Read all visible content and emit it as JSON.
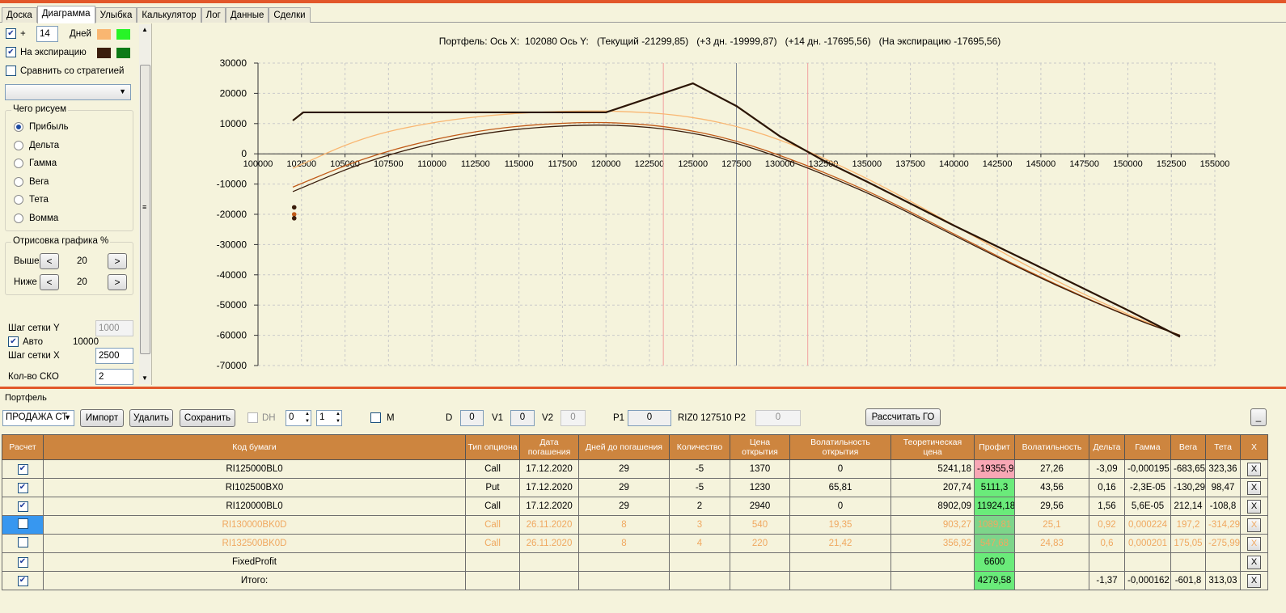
{
  "tabs": [
    "Доска",
    "Диаграмма",
    "Улыбка",
    "Калькулятор",
    "Лог",
    "Данные",
    "Сделки"
  ],
  "left": {
    "plus_label": "+",
    "days_value": "14",
    "days_label": "Дней",
    "expiry_label": "На экспирацию",
    "compare_label": "Сравнить со стратегией",
    "draw_group": "Чего рисуем",
    "radios": [
      "Прибыль",
      "Дельта",
      "Гамма",
      "Вега",
      "Тета",
      "Вомма"
    ],
    "render_group": "Отрисовка графика %",
    "above_label": "Выше",
    "above_value": "20",
    "below_label": "Ниже",
    "below_value": "20",
    "ystep_label": "Шаг сетки Y",
    "ystep_value": "1000",
    "auto_label": "Авто",
    "auto_value": "10000",
    "xstep_label": "Шаг сетки X",
    "xstep_value": "2500",
    "sko_label": "Кол-во СКО",
    "sko_value": "2",
    "colors": {
      "plus_days_1": "#f9b671",
      "plus_days_2": "#27f427",
      "expiry_1": "#3a1d0c",
      "expiry_2": "#0c7a16"
    }
  },
  "chart_data": {
    "type": "line",
    "title": "Портфель: Ось X:  102080 Ось Y:   (Текущий -21299,85)   (+3 дн. -19999,87)   (+14 дн. -17695,56)   (На экспирацию -17695,56)",
    "xlim": [
      100000,
      155000
    ],
    "ylim": [
      -70000,
      30000
    ],
    "x_ticks": [
      "100000",
      "102500",
      "105000",
      "107500",
      "110000",
      "112500",
      "115000",
      "117500",
      "120000",
      "122500",
      "125000",
      "127500",
      "130000",
      "132500",
      "135000",
      "137500",
      "140000",
      "142500",
      "145000",
      "147500",
      "150000",
      "152500",
      "155000"
    ],
    "y_ticks": [
      "30000",
      "20000",
      "10000",
      "0",
      "-10000",
      "-20000",
      "-30000",
      "-40000",
      "-50000",
      "-60000",
      "-70000"
    ],
    "vlines": [
      {
        "x": 123300,
        "color": "#f2a0a0"
      },
      {
        "x": 127500,
        "color": "#7f8894"
      },
      {
        "x": 131600,
        "color": "#f2a0a0"
      }
    ],
    "series": [
      {
        "color": "#f9b671",
        "x": [
          102000,
          106000,
          110000,
          114000,
          118000,
          121000,
          124000,
          127000,
          130000,
          133000,
          136000,
          140000,
          145000,
          150000,
          153000
        ],
        "y": [
          -4800,
          5500,
          10500,
          13200,
          14200,
          14100,
          13000,
          10000,
          4800,
          -2600,
          -11000,
          -23500,
          -39700,
          -53200,
          -60000
        ]
      },
      {
        "color": "#c05a18",
        "x": [
          102000,
          106000,
          110000,
          114000,
          118000,
          121000,
          124000,
          127000,
          130000,
          133000,
          136000,
          140000,
          145000,
          150000,
          153000
        ],
        "y": [
          -11000,
          -1500,
          4800,
          8800,
          10400,
          10300,
          8700,
          5200,
          -400,
          -7200,
          -14800,
          -26500,
          -41000,
          -53700,
          -60000
        ]
      },
      {
        "color": "#3a1d0c",
        "x": [
          102000,
          106000,
          110000,
          114000,
          118000,
          121000,
          124000,
          127000,
          130000,
          133000,
          136000,
          140000,
          145000,
          150000,
          153000
        ],
        "y": [
          -12500,
          -2800,
          3600,
          7800,
          9500,
          9500,
          7900,
          4500,
          -1100,
          -7900,
          -15400,
          -27000,
          -41300,
          -53800,
          -60000
        ]
      },
      {
        "color": "#2b1505",
        "x": [
          102000,
          102600,
          105000,
          110000,
          115000,
          120000,
          125000,
          127500,
          130000,
          132500,
          135000,
          140000,
          145000,
          150000,
          153000
        ],
        "y": [
          11000,
          13700,
          13700,
          13700,
          13700,
          13700,
          23300,
          15800,
          5800,
          -2200,
          -9200,
          -23700,
          -37600,
          -51700,
          -60500
        ]
      }
    ],
    "points": [
      {
        "x": 102080,
        "y": -17695.56,
        "color": "#3a1d0c"
      },
      {
        "x": 102080,
        "y": -19999.87,
        "color": "#c05a18"
      },
      {
        "x": 102080,
        "y": -21299.85,
        "color": "#3a1d0c"
      }
    ]
  },
  "portfolio": {
    "title": "Портфель",
    "dropdown": "ПРОДАЖА СТ",
    "import": "Импорт",
    "delete": "Удалить",
    "save": "Сохранить",
    "dh_label": "DH",
    "dh_spin1": "0",
    "dh_spin2": "1",
    "m_label": "M",
    "d_label": "D",
    "d_value": "0",
    "v1_label": "V1",
    "v1_value": "0",
    "v2_label": "V2",
    "v2_value": "0",
    "p1_label": "P1",
    "p1_value": "0",
    "riz": "RIZ0 127510",
    "p2_label": "P2",
    "p2_value": "0",
    "calc_go": "Рассчитать ГО",
    "min_btn": "_"
  },
  "table": {
    "headers": [
      "Расчет",
      "Код бумаги",
      "Тип опциона",
      "Дата погашения",
      "Дней до погашения",
      "Количество",
      "Цена открытия",
      "Волатильность открытия",
      "Теоретическая цена",
      "Профит",
      "Волатильность",
      "Дельта",
      "Гамма",
      "Вега",
      "Тета",
      "X"
    ],
    "rows": [
      {
        "checked": true,
        "code": "RI125000BL0",
        "type": "Call",
        "date": "17.12.2020",
        "days": "29",
        "qty": "-5",
        "open": "1370",
        "vol_open": "0",
        "theo": "5241,18",
        "profit": "-19355,9",
        "vol": "27,26",
        "delta": "-3,09",
        "gamma": "-0,000195",
        "vega": "-683,65",
        "theta": "323,36",
        "x": "X"
      },
      {
        "checked": true,
        "code": "RI102500BX0",
        "type": "Put",
        "date": "17.12.2020",
        "days": "29",
        "qty": "-5",
        "open": "1230",
        "vol_open": "65,81",
        "theo": "207,74",
        "profit": "5111,3",
        "vol": "43,56",
        "delta": "0,16",
        "gamma": "-2,3E-05",
        "vega": "-130,29",
        "theta": "98,47",
        "x": "X"
      },
      {
        "checked": true,
        "code": "RI120000BL0",
        "type": "Call",
        "date": "17.12.2020",
        "days": "29",
        "qty": "2",
        "open": "2940",
        "vol_open": "0",
        "theo": "8902,09",
        "profit": "11924,18",
        "vol": "29,56",
        "delta": "1,56",
        "gamma": "5,6E-05",
        "vega": "212,14",
        "theta": "-108,8",
        "x": "X"
      },
      {
        "checked": false,
        "code": "RI130000BK0D",
        "type": "Call",
        "date": "26.11.2020",
        "days": "8",
        "qty": "3",
        "open": "540",
        "vol_open": "19,35",
        "theo": "903,27",
        "profit": "1089,81",
        "vol": "25,1",
        "delta": "0,92",
        "gamma": "0,000224",
        "vega": "197,2",
        "theta": "-314,29",
        "x": "X"
      },
      {
        "checked": false,
        "code": "RI132500BK0D",
        "type": "Call",
        "date": "26.11.2020",
        "days": "8",
        "qty": "4",
        "open": "220",
        "vol_open": "21,42",
        "theo": "356,92",
        "profit": "547,68",
        "vol": "24,83",
        "delta": "0,6",
        "gamma": "0,000201",
        "vega": "175,05",
        "theta": "-275,99",
        "x": "X"
      },
      {
        "checked": true,
        "code": "FixedProfit",
        "type": "",
        "date": "",
        "days": "",
        "qty": "",
        "open": "",
        "vol_open": "",
        "theo": "",
        "profit": "6600",
        "vol": "",
        "delta": "",
        "gamma": "",
        "vega": "",
        "theta": "",
        "x": "X"
      },
      {
        "checked": true,
        "code": "Итого:",
        "type": "",
        "date": "",
        "days": "",
        "qty": "",
        "open": "",
        "vol_open": "",
        "theo": "",
        "profit": "4279,58",
        "vol": "",
        "delta": "-1,37",
        "gamma": "-0,000162",
        "vega": "-601,8",
        "theta": "313,03",
        "x": "X"
      }
    ]
  }
}
